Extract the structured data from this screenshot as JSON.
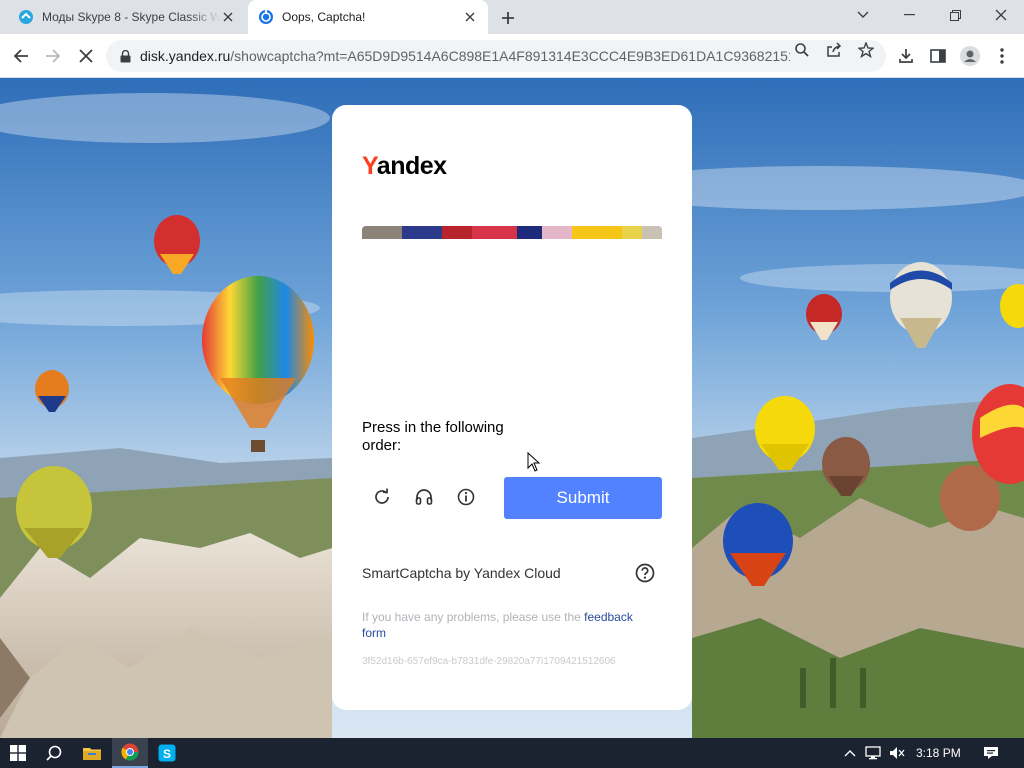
{
  "browser": {
    "tabs": [
      {
        "title": "Моды Skype 8 - Skype Classic W",
        "active": false
      },
      {
        "title": "Oops, Captcha!",
        "active": true
      }
    ],
    "url": {
      "domain": "disk.yandex.ru",
      "path": "/showcaptcha?mt=A65D9D9514A6C898E1A4F891314E3CCC4E9B3ED61DA1C936821510..."
    }
  },
  "captcha": {
    "logo_first_letter": "Y",
    "logo_rest": "andex",
    "prompt": "Press in the following order:",
    "submit_label": "Submit",
    "brand": "SmartCaptcha by Yandex Cloud",
    "problems_text": "If you have any problems, please use the ",
    "feedback_link": "feedback form",
    "token": "3f52d16b-657ef9ca-b7831dfe-29820a77i1709421512606"
  },
  "taskbar": {
    "clock": "3:18 PM"
  },
  "colors": {
    "submit": "#5282ff",
    "yandex_red": "#fc3f1d",
    "link": "#2a4b9b",
    "taskbar": "#1b2230"
  },
  "icons": [
    "skype-icon",
    "captcha-favicon",
    "close-icon",
    "new-tab-icon",
    "minimize-icon",
    "restore-icon",
    "window-close-icon",
    "chevron-down-icon",
    "back-icon",
    "forward-icon",
    "stop-icon",
    "lock-icon",
    "search-icon",
    "share-icon",
    "star-icon",
    "download-icon",
    "sidebar-icon",
    "profile-icon",
    "menu-icon",
    "refresh-icon",
    "headphones-icon",
    "info-icon",
    "help-icon",
    "windows-start-icon",
    "taskbar-search-icon",
    "file-explorer-icon",
    "chrome-icon",
    "skype-taskbar-icon",
    "tray-chevron-icon",
    "network-icon",
    "volume-muted-icon",
    "notification-icon"
  ]
}
